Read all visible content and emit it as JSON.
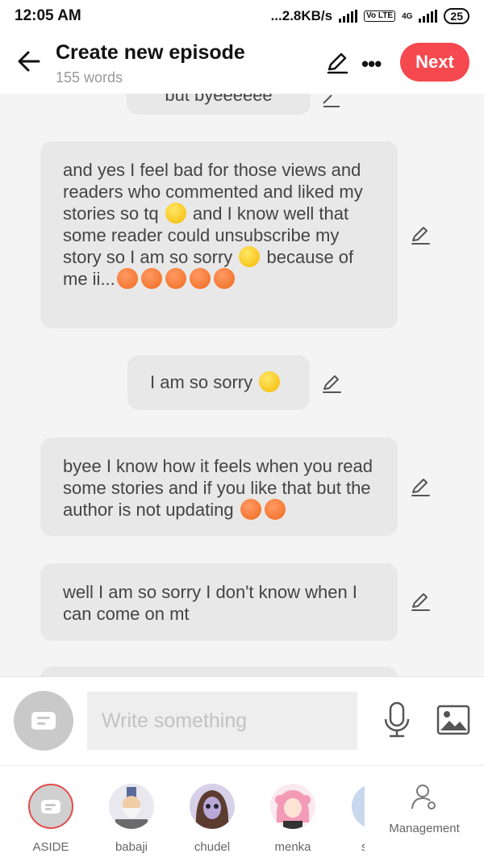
{
  "status": {
    "time": "12:05 AM",
    "speed": "2.8KB/s",
    "lte": "Vo LTE",
    "net": "4G",
    "battery": "25"
  },
  "header": {
    "title": "Create new episode",
    "subtitle": "155 words",
    "next_label": "Next"
  },
  "messages": [
    {
      "segments": [
        {
          "t": "but byeeeeee"
        }
      ]
    },
    {
      "segments": [
        {
          "t": "and yes I feel bad for those views and readers who commented and liked my stories so tq "
        },
        {
          "e": "grin"
        },
        {
          "t": " and I know well that some reader could unsubscribe my story so I am so sorry "
        },
        {
          "e": "meh"
        },
        {
          "t": " because of me ii..."
        },
        {
          "e": "cry"
        },
        {
          "e": "cry"
        },
        {
          "e": "cry"
        },
        {
          "e": "cry"
        },
        {
          "e": "cry"
        }
      ]
    },
    {
      "segments": [
        {
          "t": "I am so sorry "
        },
        {
          "e": "sad"
        }
      ]
    },
    {
      "segments": [
        {
          "t": "byee I know how it feels when you read some stories and if you like that but the author is not updating "
        },
        {
          "e": "cry"
        },
        {
          "e": "cry"
        }
      ]
    },
    {
      "segments": [
        {
          "t": "well I am so sorry I don't know when I can come on mt"
        }
      ]
    }
  ],
  "composer": {
    "placeholder": "Write something"
  },
  "characters": [
    {
      "name": "ASIDE"
    },
    {
      "name": "babaji"
    },
    {
      "name": "chudel"
    },
    {
      "name": "menka"
    },
    {
      "name": "s"
    }
  ],
  "management_label": "Management",
  "colors": {
    "accent": "#f5484f",
    "bubble": "#e8e8e8",
    "background": "#f4f4f4"
  }
}
